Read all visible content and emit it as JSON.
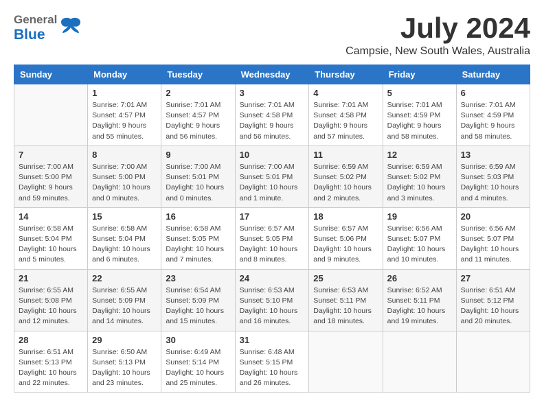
{
  "header": {
    "logo_general": "General",
    "logo_blue": "Blue",
    "month": "July 2024",
    "location": "Campsie, New South Wales, Australia"
  },
  "weekdays": [
    "Sunday",
    "Monday",
    "Tuesday",
    "Wednesday",
    "Thursday",
    "Friday",
    "Saturday"
  ],
  "weeks": [
    [
      {
        "day": "",
        "info": ""
      },
      {
        "day": "1",
        "info": "Sunrise: 7:01 AM\nSunset: 4:57 PM\nDaylight: 9 hours\nand 55 minutes."
      },
      {
        "day": "2",
        "info": "Sunrise: 7:01 AM\nSunset: 4:57 PM\nDaylight: 9 hours\nand 56 minutes."
      },
      {
        "day": "3",
        "info": "Sunrise: 7:01 AM\nSunset: 4:58 PM\nDaylight: 9 hours\nand 56 minutes."
      },
      {
        "day": "4",
        "info": "Sunrise: 7:01 AM\nSunset: 4:58 PM\nDaylight: 9 hours\nand 57 minutes."
      },
      {
        "day": "5",
        "info": "Sunrise: 7:01 AM\nSunset: 4:59 PM\nDaylight: 9 hours\nand 58 minutes."
      },
      {
        "day": "6",
        "info": "Sunrise: 7:01 AM\nSunset: 4:59 PM\nDaylight: 9 hours\nand 58 minutes."
      }
    ],
    [
      {
        "day": "7",
        "info": "Sunrise: 7:00 AM\nSunset: 5:00 PM\nDaylight: 9 hours\nand 59 minutes."
      },
      {
        "day": "8",
        "info": "Sunrise: 7:00 AM\nSunset: 5:00 PM\nDaylight: 10 hours\nand 0 minutes."
      },
      {
        "day": "9",
        "info": "Sunrise: 7:00 AM\nSunset: 5:01 PM\nDaylight: 10 hours\nand 0 minutes."
      },
      {
        "day": "10",
        "info": "Sunrise: 7:00 AM\nSunset: 5:01 PM\nDaylight: 10 hours\nand 1 minute."
      },
      {
        "day": "11",
        "info": "Sunrise: 6:59 AM\nSunset: 5:02 PM\nDaylight: 10 hours\nand 2 minutes."
      },
      {
        "day": "12",
        "info": "Sunrise: 6:59 AM\nSunset: 5:02 PM\nDaylight: 10 hours\nand 3 minutes."
      },
      {
        "day": "13",
        "info": "Sunrise: 6:59 AM\nSunset: 5:03 PM\nDaylight: 10 hours\nand 4 minutes."
      }
    ],
    [
      {
        "day": "14",
        "info": "Sunrise: 6:58 AM\nSunset: 5:04 PM\nDaylight: 10 hours\nand 5 minutes."
      },
      {
        "day": "15",
        "info": "Sunrise: 6:58 AM\nSunset: 5:04 PM\nDaylight: 10 hours\nand 6 minutes."
      },
      {
        "day": "16",
        "info": "Sunrise: 6:58 AM\nSunset: 5:05 PM\nDaylight: 10 hours\nand 7 minutes."
      },
      {
        "day": "17",
        "info": "Sunrise: 6:57 AM\nSunset: 5:05 PM\nDaylight: 10 hours\nand 8 minutes."
      },
      {
        "day": "18",
        "info": "Sunrise: 6:57 AM\nSunset: 5:06 PM\nDaylight: 10 hours\nand 9 minutes."
      },
      {
        "day": "19",
        "info": "Sunrise: 6:56 AM\nSunset: 5:07 PM\nDaylight: 10 hours\nand 10 minutes."
      },
      {
        "day": "20",
        "info": "Sunrise: 6:56 AM\nSunset: 5:07 PM\nDaylight: 10 hours\nand 11 minutes."
      }
    ],
    [
      {
        "day": "21",
        "info": "Sunrise: 6:55 AM\nSunset: 5:08 PM\nDaylight: 10 hours\nand 12 minutes."
      },
      {
        "day": "22",
        "info": "Sunrise: 6:55 AM\nSunset: 5:09 PM\nDaylight: 10 hours\nand 14 minutes."
      },
      {
        "day": "23",
        "info": "Sunrise: 6:54 AM\nSunset: 5:09 PM\nDaylight: 10 hours\nand 15 minutes."
      },
      {
        "day": "24",
        "info": "Sunrise: 6:53 AM\nSunset: 5:10 PM\nDaylight: 10 hours\nand 16 minutes."
      },
      {
        "day": "25",
        "info": "Sunrise: 6:53 AM\nSunset: 5:11 PM\nDaylight: 10 hours\nand 18 minutes."
      },
      {
        "day": "26",
        "info": "Sunrise: 6:52 AM\nSunset: 5:11 PM\nDaylight: 10 hours\nand 19 minutes."
      },
      {
        "day": "27",
        "info": "Sunrise: 6:51 AM\nSunset: 5:12 PM\nDaylight: 10 hours\nand 20 minutes."
      }
    ],
    [
      {
        "day": "28",
        "info": "Sunrise: 6:51 AM\nSunset: 5:13 PM\nDaylight: 10 hours\nand 22 minutes."
      },
      {
        "day": "29",
        "info": "Sunrise: 6:50 AM\nSunset: 5:13 PM\nDaylight: 10 hours\nand 23 minutes."
      },
      {
        "day": "30",
        "info": "Sunrise: 6:49 AM\nSunset: 5:14 PM\nDaylight: 10 hours\nand 25 minutes."
      },
      {
        "day": "31",
        "info": "Sunrise: 6:48 AM\nSunset: 5:15 PM\nDaylight: 10 hours\nand 26 minutes."
      },
      {
        "day": "",
        "info": ""
      },
      {
        "day": "",
        "info": ""
      },
      {
        "day": "",
        "info": ""
      }
    ]
  ]
}
